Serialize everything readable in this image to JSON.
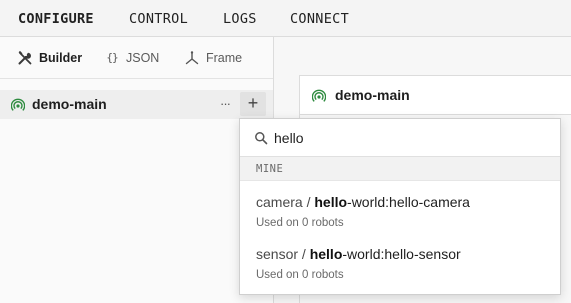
{
  "topnav": {
    "items": [
      {
        "label": "CONFIGURE",
        "active": true
      },
      {
        "label": "CONTROL",
        "active": false
      },
      {
        "label": "LOGS",
        "active": false
      },
      {
        "label": "CONNECT",
        "active": false
      }
    ]
  },
  "sidebar": {
    "tabs": [
      {
        "label": "Builder",
        "icon": "tools-icon",
        "active": true
      },
      {
        "label": "JSON",
        "icon": "curly-braces-icon",
        "glyph": "{}",
        "active": false
      },
      {
        "label": "Frame",
        "icon": "frame-axes-icon",
        "active": false
      }
    ],
    "tree": {
      "root_name": "demo-main",
      "more_glyph": "···",
      "add_glyph": "+"
    }
  },
  "main": {
    "card_title": "demo-main"
  },
  "add_menu": {
    "search": {
      "value": "hello",
      "placeholder": ""
    },
    "section_label": "MINE",
    "options": [
      {
        "type_prefix": "camera / ",
        "match": "hello",
        "rest": "-world:hello-camera",
        "subtitle": "Used on 0 robots"
      },
      {
        "type_prefix": "sensor / ",
        "match": "hello",
        "rest": "-world:hello-sensor",
        "subtitle": "Used on 0 robots"
      }
    ]
  },
  "colors": {
    "machine_icon": "#2e8b3f",
    "topnav_bg": "#f4f4f4",
    "selected_row_bg": "#eeeeee"
  }
}
